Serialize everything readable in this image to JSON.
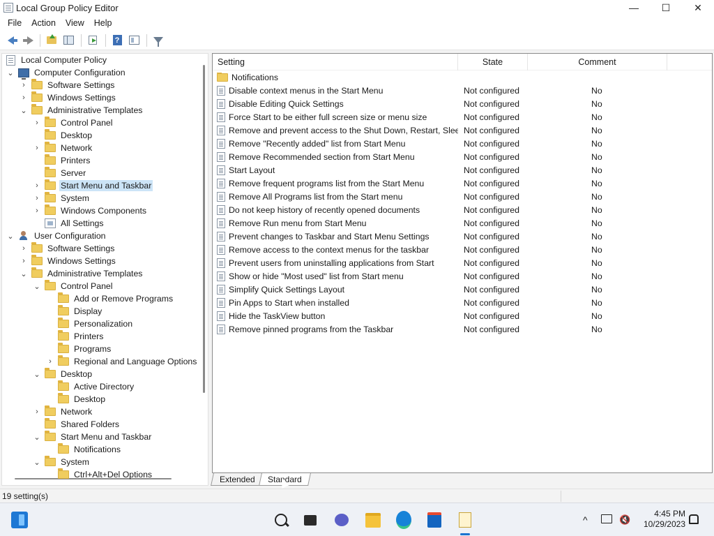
{
  "window": {
    "title": "Local Group Policy Editor",
    "minimize": "—",
    "maximize": "☐",
    "close": "✕"
  },
  "menu": [
    "File",
    "Action",
    "View",
    "Help"
  ],
  "tree": [
    {
      "label": "Local Computer Policy",
      "level": 0,
      "icon": "doc-icon",
      "exp": ""
    },
    {
      "label": "Computer Configuration",
      "level": 0,
      "icon": "computer-icon",
      "exp": "v"
    },
    {
      "label": "Software Settings",
      "level": 1,
      "icon": "folder-icon",
      "exp": ">"
    },
    {
      "label": "Windows Settings",
      "level": 1,
      "icon": "folder-icon",
      "exp": ">"
    },
    {
      "label": "Administrative Templates",
      "level": 1,
      "icon": "folder-icon",
      "exp": "v"
    },
    {
      "label": "Control Panel",
      "level": 2,
      "icon": "folder-icon",
      "exp": ">"
    },
    {
      "label": "Desktop",
      "level": 2,
      "icon": "folder-icon",
      "exp": ""
    },
    {
      "label": "Network",
      "level": 2,
      "icon": "folder-icon",
      "exp": ">"
    },
    {
      "label": "Printers",
      "level": 2,
      "icon": "folder-icon",
      "exp": ""
    },
    {
      "label": "Server",
      "level": 2,
      "icon": "folder-icon",
      "exp": ""
    },
    {
      "label": "Start Menu and Taskbar",
      "level": 2,
      "icon": "folder-icon",
      "exp": ">",
      "selected": true
    },
    {
      "label": "System",
      "level": 2,
      "icon": "folder-icon",
      "exp": ">"
    },
    {
      "label": "Windows Components",
      "level": 2,
      "icon": "folder-icon",
      "exp": ">"
    },
    {
      "label": "All Settings",
      "level": 2,
      "icon": "settings-icon",
      "exp": ""
    },
    {
      "label": "User Configuration",
      "level": 0,
      "icon": "user-icon",
      "exp": "v"
    },
    {
      "label": "Software Settings",
      "level": 1,
      "icon": "folder-icon",
      "exp": ">"
    },
    {
      "label": "Windows Settings",
      "level": 1,
      "icon": "folder-icon",
      "exp": ">"
    },
    {
      "label": "Administrative Templates",
      "level": 1,
      "icon": "folder-icon",
      "exp": "v"
    },
    {
      "label": "Control Panel",
      "level": 2,
      "icon": "folder-icon",
      "exp": "v"
    },
    {
      "label": "Add or Remove Programs",
      "level": 3,
      "icon": "folder-icon",
      "exp": ""
    },
    {
      "label": "Display",
      "level": 3,
      "icon": "folder-icon",
      "exp": ""
    },
    {
      "label": "Personalization",
      "level": 3,
      "icon": "folder-icon",
      "exp": ""
    },
    {
      "label": "Printers",
      "level": 3,
      "icon": "folder-icon",
      "exp": ""
    },
    {
      "label": "Programs",
      "level": 3,
      "icon": "folder-icon",
      "exp": ""
    },
    {
      "label": "Regional and Language Options",
      "level": 3,
      "icon": "folder-icon",
      "exp": ">"
    },
    {
      "label": "Desktop",
      "level": 2,
      "icon": "folder-icon",
      "exp": "v"
    },
    {
      "label": "Active Directory",
      "level": 3,
      "icon": "folder-icon",
      "exp": ""
    },
    {
      "label": "Desktop",
      "level": 3,
      "icon": "folder-icon",
      "exp": ""
    },
    {
      "label": "Network",
      "level": 2,
      "icon": "folder-icon",
      "exp": ">"
    },
    {
      "label": "Shared Folders",
      "level": 2,
      "icon": "folder-icon",
      "exp": ""
    },
    {
      "label": "Start Menu and Taskbar",
      "level": 2,
      "icon": "folder-icon",
      "exp": "v"
    },
    {
      "label": "Notifications",
      "level": 3,
      "icon": "folder-icon",
      "exp": ""
    },
    {
      "label": "System",
      "level": 2,
      "icon": "folder-icon",
      "exp": "v"
    },
    {
      "label": "Ctrl+Alt+Del Options",
      "level": 3,
      "icon": "folder-icon",
      "exp": ""
    }
  ],
  "columns": {
    "setting": "Setting",
    "state": "State",
    "comment": "Comment"
  },
  "folder_row": "Notifications",
  "settings": [
    {
      "name": "Disable context menus in the Start Menu",
      "state": "Not configured",
      "comment": "No"
    },
    {
      "name": "Disable Editing Quick Settings",
      "state": "Not configured",
      "comment": "No"
    },
    {
      "name": "Force Start to be either full screen size or menu size",
      "state": "Not configured",
      "comment": "No"
    },
    {
      "name": "Remove and prevent access to the Shut Down, Restart, Sleep...",
      "state": "Not configured",
      "comment": "No"
    },
    {
      "name": "Remove \"Recently added\" list from Start Menu",
      "state": "Not configured",
      "comment": "No"
    },
    {
      "name": "Remove Recommended section from Start Menu",
      "state": "Not configured",
      "comment": "No"
    },
    {
      "name": "Start Layout",
      "state": "Not configured",
      "comment": "No"
    },
    {
      "name": "Remove frequent programs list from the Start Menu",
      "state": "Not configured",
      "comment": "No"
    },
    {
      "name": "Remove All Programs list from the Start menu",
      "state": "Not configured",
      "comment": "No"
    },
    {
      "name": "Do not keep history of recently opened documents",
      "state": "Not configured",
      "comment": "No"
    },
    {
      "name": "Remove Run menu from Start Menu",
      "state": "Not configured",
      "comment": "No"
    },
    {
      "name": "Prevent changes to Taskbar and Start Menu Settings",
      "state": "Not configured",
      "comment": "No"
    },
    {
      "name": "Remove access to the context menus for the taskbar",
      "state": "Not configured",
      "comment": "No"
    },
    {
      "name": "Prevent users from uninstalling applications from Start",
      "state": "Not configured",
      "comment": "No"
    },
    {
      "name": "Show or hide \"Most used\" list from Start menu",
      "state": "Not configured",
      "comment": "No"
    },
    {
      "name": "Simplify Quick Settings Layout",
      "state": "Not configured",
      "comment": "No"
    },
    {
      "name": "Pin Apps to Start when installed",
      "state": "Not configured",
      "comment": "No"
    },
    {
      "name": "Hide the TaskView button",
      "state": "Not configured",
      "comment": "No"
    },
    {
      "name": "Remove pinned programs from the Taskbar",
      "state": "Not configured",
      "comment": "No"
    }
  ],
  "tabs": [
    "Extended",
    "Standard"
  ],
  "status": "19 setting(s)",
  "clock": {
    "time": "4:45 PM",
    "date": "10/29/2023"
  },
  "tray": {
    "chevron": "^",
    "volume": "🔇"
  }
}
